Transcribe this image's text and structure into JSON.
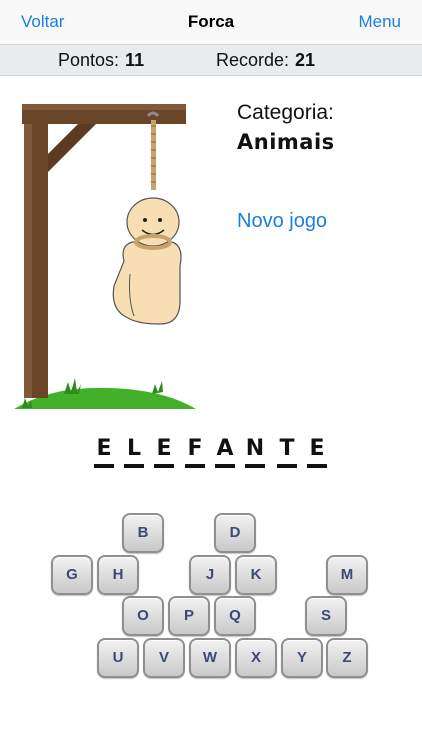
{
  "nav": {
    "back_label": "Voltar",
    "title": "Forca",
    "menu_label": "Menu"
  },
  "score": {
    "points_label": "Pontos:",
    "points_value": "11",
    "record_label": "Recorde:",
    "record_value": "21"
  },
  "category": {
    "label": "Categoria:",
    "value": "Animais"
  },
  "new_game_label": "Novo jogo",
  "word": [
    "E",
    "L",
    "E",
    "F",
    "A",
    "N",
    "T",
    "E"
  ],
  "keyboard": {
    "row1": [
      "B",
      "D"
    ],
    "row2": [
      "G",
      "H",
      "J",
      "K",
      "M"
    ],
    "row3": [
      "O",
      "P",
      "Q",
      "S"
    ],
    "row4": [
      "U",
      "V",
      "W",
      "X",
      "Y",
      "Z"
    ]
  },
  "colors": {
    "accent": "#1a7fe0",
    "key_text": "#3d4a73"
  }
}
